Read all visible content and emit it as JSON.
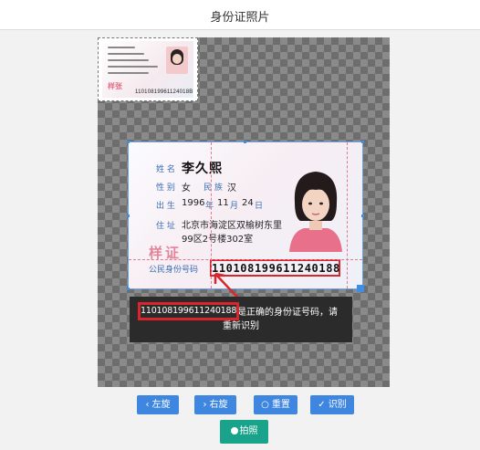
{
  "header": {
    "title": "身份证照片"
  },
  "thumbnail": {
    "seal": "样张",
    "id_number": "11010819961124018B"
  },
  "card": {
    "name_label": "姓 名",
    "name": "李久熙",
    "gender_label": "性 别",
    "gender": "女",
    "ethnicity_label": "民 族",
    "ethnicity": "汉",
    "birth_label": "出 生",
    "birth_year": "1996",
    "birth_year_unit": "年",
    "birth_month": "11",
    "birth_month_unit": "月",
    "birth_day": "24",
    "birth_day_unit": "日",
    "address_label": "住 址",
    "address_line1": "北京市海淀区双榆树东里",
    "address_line2": "99区2号楼302室",
    "seal": "样证",
    "id_label": "公民身份号码",
    "id_number": "110108199611240188"
  },
  "callout": {
    "detected_number": "110108199611240188",
    "message_line1": "是正确的身份证号码，请",
    "message_line2": "重新识别"
  },
  "toolbar": {
    "rotate_left_label": "左旋",
    "rotate_right_label": "右旋",
    "reset_label": "重置",
    "recognize_label": "识别",
    "shoot_label": "拍照"
  },
  "colors": {
    "button_blue": "#3f86e0",
    "button_green": "#19a38a",
    "highlight_red": "#d9252b"
  }
}
